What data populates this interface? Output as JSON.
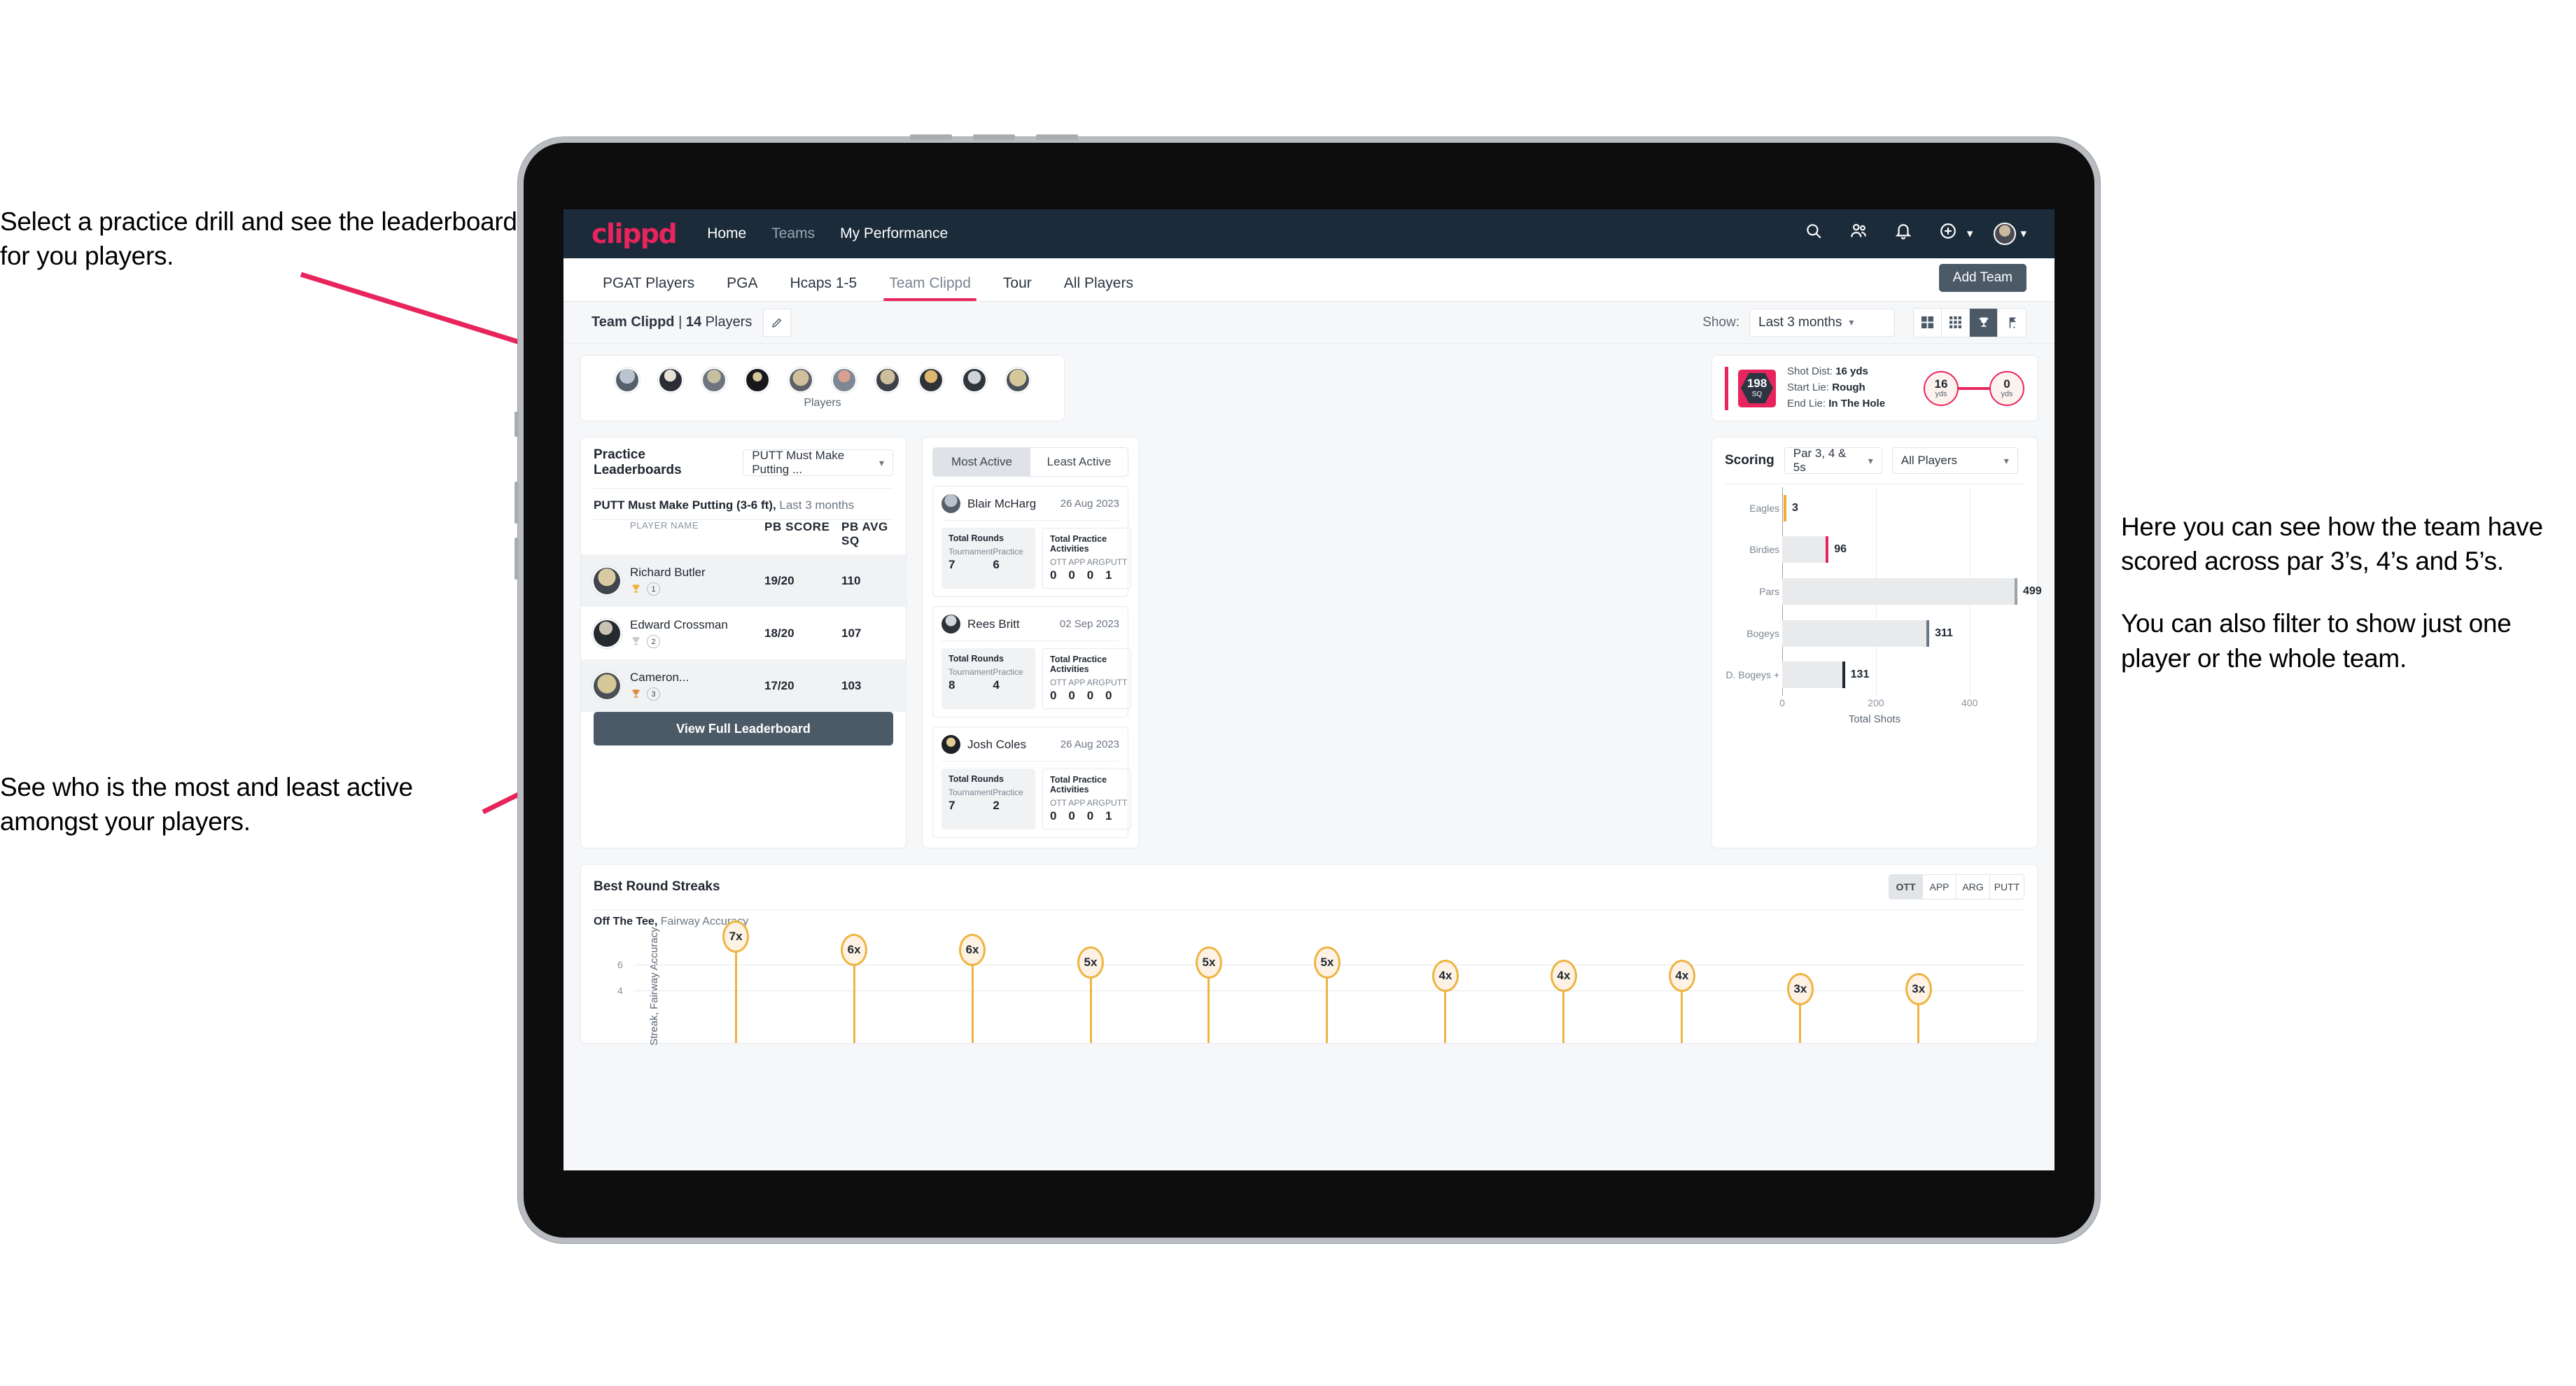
{
  "annotations": {
    "top_left": "Select a practice drill and see the leaderboard for you players.",
    "bottom_left": "See who is the most and least active amongst your players.",
    "right_1": "Here you can see how the team have scored across par 3’s, 4’s and 5’s.",
    "right_2": "You can also filter to show just one player or the whole team."
  },
  "appbar": {
    "logo": "clippd",
    "nav": [
      {
        "label": "Home",
        "dim": false
      },
      {
        "label": "Teams",
        "dim": true
      },
      {
        "label": "My Performance",
        "dim": false
      }
    ],
    "icons": [
      "search-icon",
      "people-icon",
      "bell-icon",
      "plus-circle-icon",
      "avatar"
    ]
  },
  "tabs": {
    "items": [
      {
        "label": "PGAT Players",
        "active": false
      },
      {
        "label": "PGA",
        "active": false
      },
      {
        "label": "Hcaps 1-5",
        "active": false
      },
      {
        "label": "Team Clippd",
        "active": true
      },
      {
        "label": "Tour",
        "active": false
      },
      {
        "label": "All Players",
        "active": false
      }
    ],
    "add_team": "Add Team"
  },
  "subbar": {
    "team_name": "Team Clippd",
    "separator": " | ",
    "player_count": "14",
    "players_word": "Players",
    "edit_icon": "pencil-icon",
    "show_label": "Show:",
    "show_value": "Last 3 months",
    "view_modes": [
      {
        "name": "grid-large-icon",
        "active": false
      },
      {
        "name": "grid-small-icon",
        "active": false
      },
      {
        "name": "trophy-icon",
        "active": true
      },
      {
        "name": "flag-icon",
        "active": false
      }
    ]
  },
  "players_strip": {
    "label": "Players",
    "count": 10
  },
  "shot_card": {
    "sq_value": "198",
    "sq_unit": "SQ",
    "rows": [
      {
        "label": "Shot Dist:",
        "value": "16 yds"
      },
      {
        "label": "Start Lie:",
        "value": "Rough"
      },
      {
        "label": "End Lie:",
        "value": "In The Hole"
      }
    ],
    "start_node": {
      "value": "16",
      "unit": "yds"
    },
    "end_node": {
      "value": "0",
      "unit": "yds"
    }
  },
  "leaderboard": {
    "title": "Practice Leaderboards",
    "drill_select": "PUTT Must Make Putting ...",
    "subtitle_bold": "PUTT Must Make Putting (3-6 ft),",
    "subtitle_rest": " Last 3 months",
    "columns": [
      "PLAYER NAME",
      "PB SCORE",
      "PB AVG SQ"
    ],
    "rows": [
      {
        "name": "Richard Butler",
        "rank": "1",
        "score": "19/20",
        "sq": "110",
        "trophy": "gold"
      },
      {
        "name": "Edward Crossman",
        "rank": "2",
        "score": "18/20",
        "sq": "107",
        "trophy": "silver"
      },
      {
        "name": "Cameron...",
        "rank": "3",
        "score": "17/20",
        "sq": "103",
        "trophy": "bronze"
      }
    ],
    "view_full": "View Full Leaderboard"
  },
  "activity": {
    "tabs": [
      {
        "label": "Most Active",
        "active": true
      },
      {
        "label": "Least Active",
        "active": false
      }
    ],
    "total_rounds_title": "Total Rounds",
    "total_practice_title": "Total Practice Activities",
    "round_keys": [
      "Tournament",
      "Practice"
    ],
    "practice_keys": [
      "OTT",
      "APP",
      "ARG",
      "PUTT"
    ],
    "players": [
      {
        "name": "Blair McHarg",
        "date": "26 Aug 2023",
        "rounds": [
          "7",
          "6"
        ],
        "practice": [
          "0",
          "0",
          "0",
          "1"
        ]
      },
      {
        "name": "Rees Britt",
        "date": "02 Sep 2023",
        "rounds": [
          "8",
          "4"
        ],
        "practice": [
          "0",
          "0",
          "0",
          "0"
        ]
      },
      {
        "name": "Josh Coles",
        "date": "26 Aug 2023",
        "rounds": [
          "7",
          "2"
        ],
        "practice": [
          "0",
          "0",
          "0",
          "1"
        ]
      }
    ]
  },
  "scoring": {
    "title": "Scoring",
    "par_select": "Par 3, 4 & 5s",
    "player_select": "All Players"
  },
  "streaks": {
    "title": "Best Round Streaks",
    "toggles": [
      {
        "label": "OTT",
        "active": true
      },
      {
        "label": "APP",
        "active": false
      },
      {
        "label": "ARG",
        "active": false
      },
      {
        "label": "PUTT",
        "active": false
      }
    ],
    "sub_bold": "Off The Tee,",
    "sub_rest": " Fairway Accuracy"
  },
  "chart_data": [
    {
      "type": "bar",
      "title": "Scoring",
      "orientation": "horizontal",
      "categories": [
        "Eagles",
        "Birdies",
        "Pars",
        "Bogeys",
        "D. Bogeys +"
      ],
      "values": [
        3,
        96,
        499,
        311,
        131
      ],
      "cap_colors": [
        "#f0ad2e",
        "#e8245c",
        "#9aa2aa",
        "#6b7682",
        "#1f2630"
      ],
      "xlabel": "Total Shots",
      "ylabel": "",
      "xlim": [
        0,
        520
      ],
      "xticks": [
        0,
        200,
        400
      ],
      "grid": true,
      "legend": "none"
    },
    {
      "type": "bar",
      "title": "Best Round Streaks",
      "subtitle": "Off The Tee, Fairway Accuracy",
      "ylabel": "Streak, Fairway Accuracy",
      "values": [
        7,
        6,
        6,
        5,
        5,
        5,
        4,
        4,
        4,
        3,
        3
      ],
      "labels": [
        "7x",
        "6x",
        "6x",
        "5x",
        "5x",
        "5x",
        "4x",
        "4x",
        "4x",
        "3x",
        "3x"
      ],
      "yticks": [
        4,
        6
      ],
      "ylim": [
        0,
        8
      ],
      "grid": true,
      "legend": "none"
    }
  ]
}
